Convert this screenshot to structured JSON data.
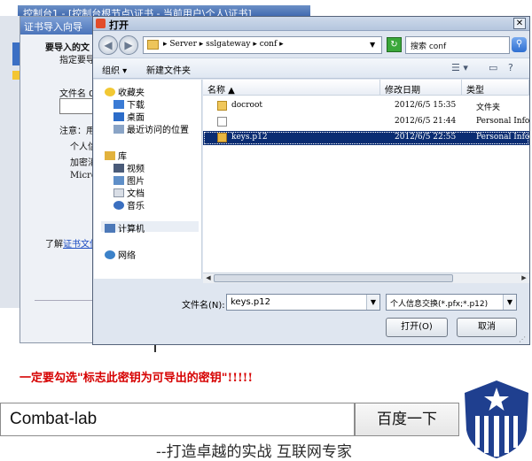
{
  "background_window": {
    "console_title": "控制台1 - [控制台根节点\\证书 - 当前用户\\个人\\证书]",
    "wizard_title": "证书导入向导",
    "heading": "要导入的文",
    "subheading": "指定要导",
    "file_name_label": "文件名 0",
    "note_label": "注意：用",
    "line_personal": "个人信",
    "line_encrypt": "加密消",
    "line_micro": "Micro",
    "learn_more_prefix": "了解",
    "learn_more_link": "证书文件"
  },
  "dialog": {
    "title": "打开",
    "close_glyph": "✕",
    "address_path": "▸ Server ▸ sslgateway ▸ conf ▸",
    "search_placeholder": "搜索 conf",
    "toolbar": {
      "organize": "组织 ▾",
      "new_folder": "新建文件夹"
    },
    "nav": {
      "favorites": "收藏夹",
      "downloads": "下载",
      "desktop": "桌面",
      "recent": "最近访问的位置",
      "libraries": "库",
      "videos": "视频",
      "pictures": "图片",
      "documents": "文档",
      "music": "音乐",
      "computer": "计算机",
      "network": "网络"
    },
    "columns": {
      "name": "名称 ▲",
      "modified": "修改日期",
      "type": "类型"
    },
    "files": [
      {
        "name": "docroot",
        "modified": "2012/6/5 15:35",
        "type": "文件夹",
        "icon": "folder-icon"
      },
      {
        "name": "",
        "modified": "2012/6/5 21:44",
        "type": "Personal Info",
        "icon": "file-icon"
      },
      {
        "name": "keys.p12",
        "modified": "2012/6/5 22:55",
        "type": "Personal Info",
        "icon": "certificate-icon",
        "selected": true
      }
    ],
    "file_name_label": "文件名(N):",
    "file_name_value": "keys.p12",
    "file_type_value": "个人信息交换(*.pfx;*.p12)",
    "open_button": "打开(O)",
    "cancel_button": "取消"
  },
  "warning_text": "一定要勾选\"标志此密钥为可导出的密钥\"!!!!!",
  "search_box_value": "Combat-lab",
  "search_button": "百度一下",
  "slogan": "--打造卓越的实战 互联网专家",
  "colors": {
    "warning": "#d60000",
    "selection": "#0a2c72",
    "shield": "#1f3f8f"
  }
}
